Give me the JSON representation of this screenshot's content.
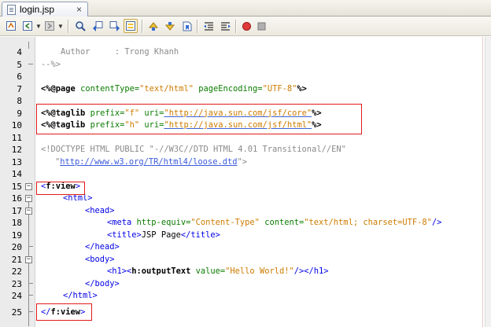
{
  "tab": {
    "label": "login.jsp",
    "close": "×"
  },
  "toolbar": {
    "icons": [
      "last-edit-icon",
      "back-icon",
      "forward-icon",
      "find-selection-icon",
      "find-previous-icon",
      "find-next-icon",
      "toggle-highlight-icon",
      "previous-bookmark-icon",
      "next-bookmark-icon",
      "toggle-bookmark-icon",
      "shift-left-icon",
      "shift-right-icon",
      "start-macro-icon",
      "stop-macro-icon"
    ]
  },
  "editor": {
    "lines": [
      {
        "n": "4",
        "text": "Author     : Trong Khanh"
      },
      {
        "n": "5",
        "text": "--%>"
      },
      {
        "n": "6",
        "text": ""
      },
      {
        "n": "7",
        "p1": "<%@",
        "p2": "page",
        "p3": " contentType=",
        "p4": "\"text/html\"",
        "p5": " pageEncoding=",
        "p6": "\"UTF-8\"",
        "p7": "%>"
      },
      {
        "n": "8",
        "text": ""
      },
      {
        "n": "9",
        "p1": "<%@",
        "p2": "taglib",
        "p3": " prefix=",
        "p4": "\"f\"",
        "p5": " uri=",
        "p6": "\"http://java.sun.com/jsf/core\"",
        "p7": "%>"
      },
      {
        "n": "10",
        "p1": "<%@",
        "p2": "taglib",
        "p3": " prefix=",
        "p4": "\"h\"",
        "p5": " uri=",
        "p6": "\"http://java.sun.com/jsf/html\"",
        "p7": "%>"
      },
      {
        "n": "11",
        "text": ""
      },
      {
        "n": "12",
        "text": "<!DOCTYPE HTML PUBLIC \"-//W3C//DTD HTML 4.01 Transitional//EN\""
      },
      {
        "n": "13",
        "q1": "\"",
        "url": "http://www.w3.org/TR/html4/loose.dtd",
        "q2": "\">"
      },
      {
        "n": "14",
        "text": ""
      },
      {
        "n": "15",
        "a": "<",
        "b": "f:view",
        "c": ">"
      },
      {
        "n": "16",
        "text": "<html>"
      },
      {
        "n": "17",
        "text": "<head>"
      },
      {
        "n": "18",
        "t1": "<meta",
        "a1": " http-equiv=",
        "v1": "\"Content-Type\"",
        "a2": " content=",
        "v2": "\"text/html; charset=UTF-8\"",
        "t2": "/>"
      },
      {
        "n": "19",
        "t1": "<title>",
        "mid": "JSP Page",
        "t2": "</title>"
      },
      {
        "n": "20",
        "text": "</head>"
      },
      {
        "n": "21",
        "text": "<body>"
      },
      {
        "n": "22",
        "t1": "<h1><",
        "b": "h:outputText",
        "a1": " value=",
        "v1": "\"Hello World!\"",
        "t2": "/></h1>"
      },
      {
        "n": "23",
        "text": "</body>"
      },
      {
        "n": "24",
        "text": "</html>"
      },
      {
        "n": "25",
        "a": "</",
        "b": "f:view",
        "c": ">"
      }
    ]
  },
  "colors": {
    "keyword": "#000000",
    "tag": "#0000e6",
    "attribute": "#0b7b00",
    "value": "#ce7b00",
    "comment": "#8a8a8a",
    "highlight_box": "#e01a1a"
  }
}
